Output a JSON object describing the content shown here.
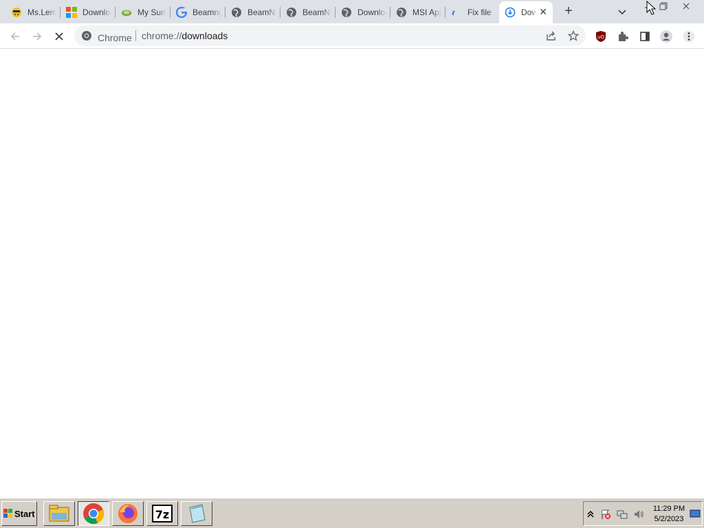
{
  "browser": {
    "tabs": [
      {
        "title": "Ms.Lemons",
        "favicon": "lemon-face-icon"
      },
      {
        "title": "Downloads",
        "favicon": "microsoft-logo-icon"
      },
      {
        "title": "My Summer Car",
        "favicon": "car-game-icon"
      },
      {
        "title": "Beamng",
        "favicon": "google-g-icon"
      },
      {
        "title": "BeamNG",
        "favicon": "globe-icon"
      },
      {
        "title": "BeamNG",
        "favicon": "globe-icon"
      },
      {
        "title": "Downloads",
        "favicon": "globe-icon"
      },
      {
        "title": "MSI Apps",
        "favicon": "globe-icon"
      },
      {
        "title": "Fix file",
        "favicon": "loading-icon"
      }
    ],
    "active_tab": {
      "title": "Downloads",
      "favicon": "download-progress-icon"
    },
    "new_tab_label": "+",
    "omnibox": {
      "chip_label": "Chrome",
      "url_scheme": "chrome://",
      "url_path": "downloads"
    }
  },
  "taskbar": {
    "start_label": "Start",
    "apps": [
      {
        "name": "file-explorer-icon"
      },
      {
        "name": "chrome-icon"
      },
      {
        "name": "firefox-icon"
      },
      {
        "name": "7zip-icon",
        "label": "7z"
      },
      {
        "name": "notepad-icon"
      }
    ],
    "clock_time": "11:29 PM",
    "clock_date": "5/2/2023"
  },
  "colors": {
    "tabstrip": "#dee1e6",
    "omnibox": "#f1f3f4",
    "taskbar": "#d4d0c8",
    "ublock": "#800000"
  }
}
